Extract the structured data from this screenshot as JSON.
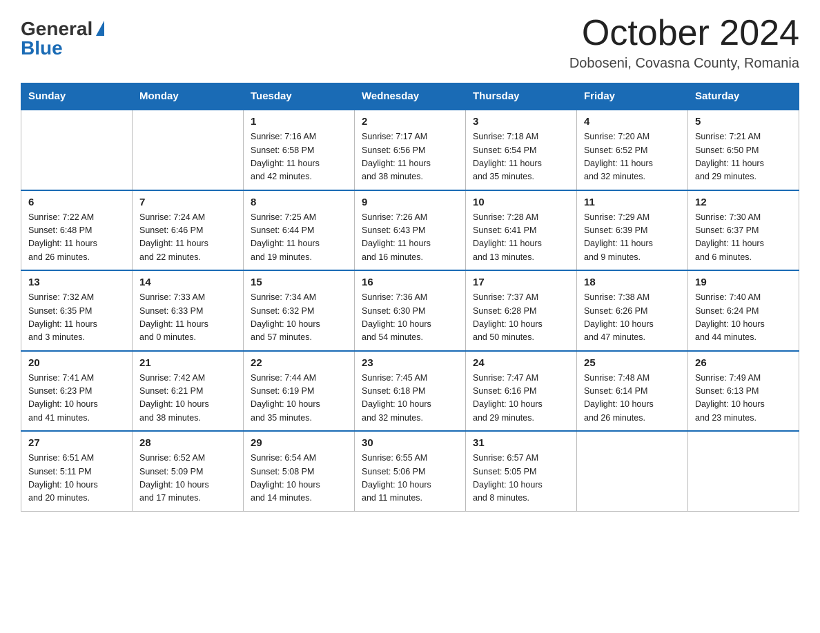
{
  "logo": {
    "general": "General",
    "blue": "Blue"
  },
  "title": "October 2024",
  "location": "Doboseni, Covasna County, Romania",
  "days_header": [
    "Sunday",
    "Monday",
    "Tuesday",
    "Wednesday",
    "Thursday",
    "Friday",
    "Saturday"
  ],
  "weeks": [
    [
      {
        "day": "",
        "detail": ""
      },
      {
        "day": "",
        "detail": ""
      },
      {
        "day": "1",
        "detail": "Sunrise: 7:16 AM\nSunset: 6:58 PM\nDaylight: 11 hours\nand 42 minutes."
      },
      {
        "day": "2",
        "detail": "Sunrise: 7:17 AM\nSunset: 6:56 PM\nDaylight: 11 hours\nand 38 minutes."
      },
      {
        "day": "3",
        "detail": "Sunrise: 7:18 AM\nSunset: 6:54 PM\nDaylight: 11 hours\nand 35 minutes."
      },
      {
        "day": "4",
        "detail": "Sunrise: 7:20 AM\nSunset: 6:52 PM\nDaylight: 11 hours\nand 32 minutes."
      },
      {
        "day": "5",
        "detail": "Sunrise: 7:21 AM\nSunset: 6:50 PM\nDaylight: 11 hours\nand 29 minutes."
      }
    ],
    [
      {
        "day": "6",
        "detail": "Sunrise: 7:22 AM\nSunset: 6:48 PM\nDaylight: 11 hours\nand 26 minutes."
      },
      {
        "day": "7",
        "detail": "Sunrise: 7:24 AM\nSunset: 6:46 PM\nDaylight: 11 hours\nand 22 minutes."
      },
      {
        "day": "8",
        "detail": "Sunrise: 7:25 AM\nSunset: 6:44 PM\nDaylight: 11 hours\nand 19 minutes."
      },
      {
        "day": "9",
        "detail": "Sunrise: 7:26 AM\nSunset: 6:43 PM\nDaylight: 11 hours\nand 16 minutes."
      },
      {
        "day": "10",
        "detail": "Sunrise: 7:28 AM\nSunset: 6:41 PM\nDaylight: 11 hours\nand 13 minutes."
      },
      {
        "day": "11",
        "detail": "Sunrise: 7:29 AM\nSunset: 6:39 PM\nDaylight: 11 hours\nand 9 minutes."
      },
      {
        "day": "12",
        "detail": "Sunrise: 7:30 AM\nSunset: 6:37 PM\nDaylight: 11 hours\nand 6 minutes."
      }
    ],
    [
      {
        "day": "13",
        "detail": "Sunrise: 7:32 AM\nSunset: 6:35 PM\nDaylight: 11 hours\nand 3 minutes."
      },
      {
        "day": "14",
        "detail": "Sunrise: 7:33 AM\nSunset: 6:33 PM\nDaylight: 11 hours\nand 0 minutes."
      },
      {
        "day": "15",
        "detail": "Sunrise: 7:34 AM\nSunset: 6:32 PM\nDaylight: 10 hours\nand 57 minutes."
      },
      {
        "day": "16",
        "detail": "Sunrise: 7:36 AM\nSunset: 6:30 PM\nDaylight: 10 hours\nand 54 minutes."
      },
      {
        "day": "17",
        "detail": "Sunrise: 7:37 AM\nSunset: 6:28 PM\nDaylight: 10 hours\nand 50 minutes."
      },
      {
        "day": "18",
        "detail": "Sunrise: 7:38 AM\nSunset: 6:26 PM\nDaylight: 10 hours\nand 47 minutes."
      },
      {
        "day": "19",
        "detail": "Sunrise: 7:40 AM\nSunset: 6:24 PM\nDaylight: 10 hours\nand 44 minutes."
      }
    ],
    [
      {
        "day": "20",
        "detail": "Sunrise: 7:41 AM\nSunset: 6:23 PM\nDaylight: 10 hours\nand 41 minutes."
      },
      {
        "day": "21",
        "detail": "Sunrise: 7:42 AM\nSunset: 6:21 PM\nDaylight: 10 hours\nand 38 minutes."
      },
      {
        "day": "22",
        "detail": "Sunrise: 7:44 AM\nSunset: 6:19 PM\nDaylight: 10 hours\nand 35 minutes."
      },
      {
        "day": "23",
        "detail": "Sunrise: 7:45 AM\nSunset: 6:18 PM\nDaylight: 10 hours\nand 32 minutes."
      },
      {
        "day": "24",
        "detail": "Sunrise: 7:47 AM\nSunset: 6:16 PM\nDaylight: 10 hours\nand 29 minutes."
      },
      {
        "day": "25",
        "detail": "Sunrise: 7:48 AM\nSunset: 6:14 PM\nDaylight: 10 hours\nand 26 minutes."
      },
      {
        "day": "26",
        "detail": "Sunrise: 7:49 AM\nSunset: 6:13 PM\nDaylight: 10 hours\nand 23 minutes."
      }
    ],
    [
      {
        "day": "27",
        "detail": "Sunrise: 6:51 AM\nSunset: 5:11 PM\nDaylight: 10 hours\nand 20 minutes."
      },
      {
        "day": "28",
        "detail": "Sunrise: 6:52 AM\nSunset: 5:09 PM\nDaylight: 10 hours\nand 17 minutes."
      },
      {
        "day": "29",
        "detail": "Sunrise: 6:54 AM\nSunset: 5:08 PM\nDaylight: 10 hours\nand 14 minutes."
      },
      {
        "day": "30",
        "detail": "Sunrise: 6:55 AM\nSunset: 5:06 PM\nDaylight: 10 hours\nand 11 minutes."
      },
      {
        "day": "31",
        "detail": "Sunrise: 6:57 AM\nSunset: 5:05 PM\nDaylight: 10 hours\nand 8 minutes."
      },
      {
        "day": "",
        "detail": ""
      },
      {
        "day": "",
        "detail": ""
      }
    ]
  ]
}
